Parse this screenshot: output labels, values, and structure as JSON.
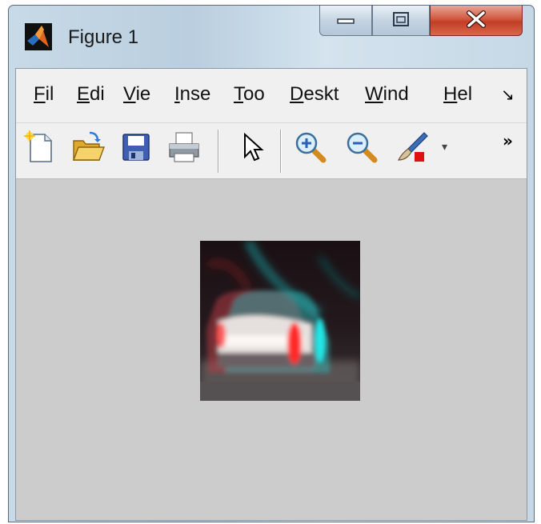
{
  "window": {
    "title": "Figure 1",
    "icon": "matlab-logo-icon",
    "controls": [
      "minimize-icon",
      "maximize-icon",
      "close-icon"
    ]
  },
  "menu": {
    "items": [
      {
        "label_u": "F",
        "label_rest": "il"
      },
      {
        "label_u": "E",
        "label_rest": "di"
      },
      {
        "label_u": "V",
        "label_rest": "ie"
      },
      {
        "label_u": "I",
        "label_rest": "nse"
      },
      {
        "label_u": "T",
        "label_rest": "oo"
      },
      {
        "label_u": "D",
        "label_rest": "eskt"
      },
      {
        "label_u": "W",
        "label_rest": "ind"
      },
      {
        "label_u": "H",
        "label_rest": "el"
      }
    ],
    "overflow_symbol": "↘"
  },
  "toolbar": {
    "buttons": [
      "new-figure-icon",
      "open-file-icon",
      "save-icon",
      "print-icon",
      "select-arrow-icon",
      "zoom-in-icon",
      "zoom-out-icon",
      "brush-icon"
    ],
    "dropdown_symbol": "▾",
    "overflow_symbol": "»"
  },
  "colors": {
    "figure_background": "#cccccc",
    "menu_background": "#f0f0f0",
    "close_button": "#c9442b",
    "anaglyph_red": "#ff2020",
    "anaglyph_cyan": "#20e0e0"
  }
}
